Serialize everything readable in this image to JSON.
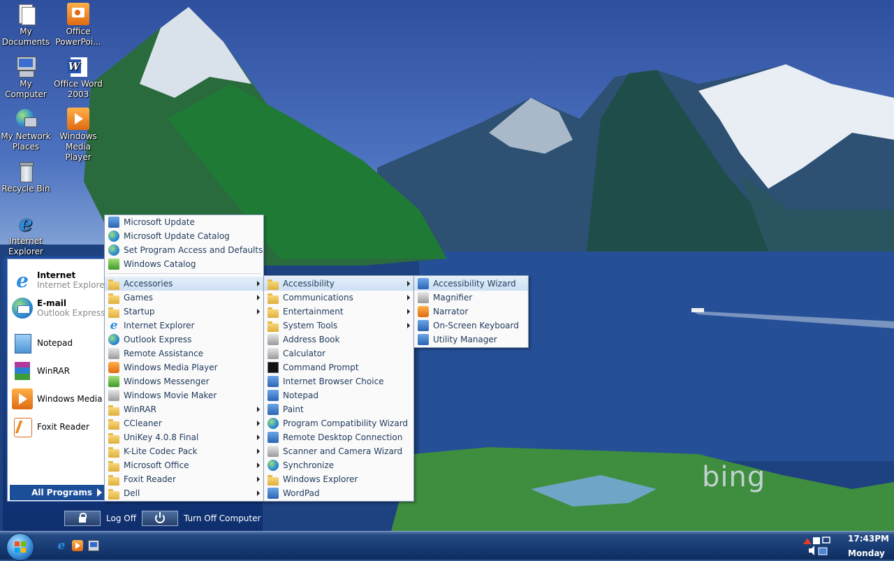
{
  "desktop": {
    "icons": [
      {
        "label": "My Documents",
        "icon": "my-documents-icon"
      },
      {
        "label": "Office PowerPoi...",
        "icon": "powerpoint-icon"
      },
      {
        "label": "My Computer",
        "icon": "my-computer-icon"
      },
      {
        "label": "Office Word 2003",
        "icon": "word-icon"
      },
      {
        "label": "My Network Places",
        "icon": "network-places-icon"
      },
      {
        "label": "Windows Media Player",
        "icon": "media-player-icon"
      },
      {
        "label": "Recycle Bin",
        "icon": "recycle-bin-icon"
      },
      {
        "label": "Internet Explorer",
        "icon": "internet-explorer-icon"
      }
    ],
    "watermark": "bing"
  },
  "start_menu": {
    "pinned": [
      {
        "title": "Internet",
        "subtitle": "Internet Explorer",
        "icon": "internet-explorer-icon"
      },
      {
        "title": "E-mail",
        "subtitle": "Outlook Express",
        "icon": "outlook-express-icon"
      }
    ],
    "recent": [
      {
        "label": "Notepad",
        "icon": "notepad-icon"
      },
      {
        "label": "WinRAR",
        "icon": "winrar-icon"
      },
      {
        "label": "Windows Media Pl",
        "icon": "media-player-icon"
      },
      {
        "label": "Foxit Reader",
        "icon": "foxit-reader-icon"
      }
    ],
    "all_programs": "All Programs",
    "log_off": "Log Off",
    "turn_off": "Turn Off Computer"
  },
  "programs_menu": {
    "top": [
      {
        "label": "Microsoft Update",
        "icon": "update-icon"
      },
      {
        "label": "Microsoft Update Catalog",
        "icon": "globe-icon"
      },
      {
        "label": "Set Program Access and Defaults",
        "icon": "defaults-icon"
      },
      {
        "label": "Windows Catalog",
        "icon": "catalog-icon"
      }
    ],
    "items": [
      {
        "label": "Accessories",
        "icon": "folder-icon",
        "submenu": true,
        "selected": true
      },
      {
        "label": "Games",
        "icon": "folder-icon",
        "submenu": true
      },
      {
        "label": "Startup",
        "icon": "folder-icon",
        "submenu": true
      },
      {
        "label": "Internet Explorer",
        "icon": "internet-explorer-icon"
      },
      {
        "label": "Outlook Express",
        "icon": "outlook-express-icon"
      },
      {
        "label": "Remote Assistance",
        "icon": "remote-assistance-icon"
      },
      {
        "label": "Windows Media Player",
        "icon": "media-player-icon"
      },
      {
        "label": "Windows Messenger",
        "icon": "messenger-icon"
      },
      {
        "label": "Windows Movie Maker",
        "icon": "movie-maker-icon"
      },
      {
        "label": "WinRAR",
        "icon": "folder-icon",
        "submenu": true
      },
      {
        "label": "CCleaner",
        "icon": "folder-icon",
        "submenu": true
      },
      {
        "label": "UniKey 4.0.8 Final",
        "icon": "folder-icon",
        "submenu": true
      },
      {
        "label": "K-Lite Codec Pack",
        "icon": "folder-icon",
        "submenu": true
      },
      {
        "label": "Microsoft Office",
        "icon": "folder-icon",
        "submenu": true
      },
      {
        "label": "Foxit Reader",
        "icon": "folder-icon",
        "submenu": true
      },
      {
        "label": "Dell",
        "icon": "folder-icon",
        "submenu": true
      }
    ]
  },
  "accessories_menu": {
    "items": [
      {
        "label": "Accessibility",
        "icon": "folder-icon",
        "submenu": true,
        "selected": true
      },
      {
        "label": "Communications",
        "icon": "folder-icon",
        "submenu": true
      },
      {
        "label": "Entertainment",
        "icon": "folder-icon",
        "submenu": true
      },
      {
        "label": "System Tools",
        "icon": "folder-icon",
        "submenu": true
      },
      {
        "label": "Address Book",
        "icon": "address-book-icon"
      },
      {
        "label": "Calculator",
        "icon": "calculator-icon"
      },
      {
        "label": "Command Prompt",
        "icon": "command-prompt-icon"
      },
      {
        "label": "Internet Browser Choice",
        "icon": "browser-choice-icon"
      },
      {
        "label": "Notepad",
        "icon": "notepad-icon"
      },
      {
        "label": "Paint",
        "icon": "paint-icon"
      },
      {
        "label": "Program Compatibility Wizard",
        "icon": "compatibility-icon"
      },
      {
        "label": "Remote Desktop Connection",
        "icon": "remote-desktop-icon"
      },
      {
        "label": "Scanner and Camera Wizard",
        "icon": "scanner-icon"
      },
      {
        "label": "Synchronize",
        "icon": "synchronize-icon"
      },
      {
        "label": "Windows Explorer",
        "icon": "explorer-icon"
      },
      {
        "label": "WordPad",
        "icon": "wordpad-icon"
      }
    ]
  },
  "accessibility_menu": {
    "items": [
      {
        "label": "Accessibility Wizard",
        "icon": "accessibility-wizard-icon",
        "selected": true
      },
      {
        "label": "Magnifier",
        "icon": "magnifier-icon"
      },
      {
        "label": "Narrator",
        "icon": "narrator-icon"
      },
      {
        "label": "On-Screen Keyboard",
        "icon": "keyboard-icon"
      },
      {
        "label": "Utility Manager",
        "icon": "utility-manager-icon"
      }
    ]
  },
  "taskbar": {
    "quick_launch": [
      "internet-explorer-icon",
      "media-player-icon",
      "show-desktop-icon"
    ],
    "tray": [
      "network-icon",
      "volume-icon",
      "safely-remove-icon"
    ],
    "clock_time": "17:43PM",
    "clock_day": "Monday"
  }
}
